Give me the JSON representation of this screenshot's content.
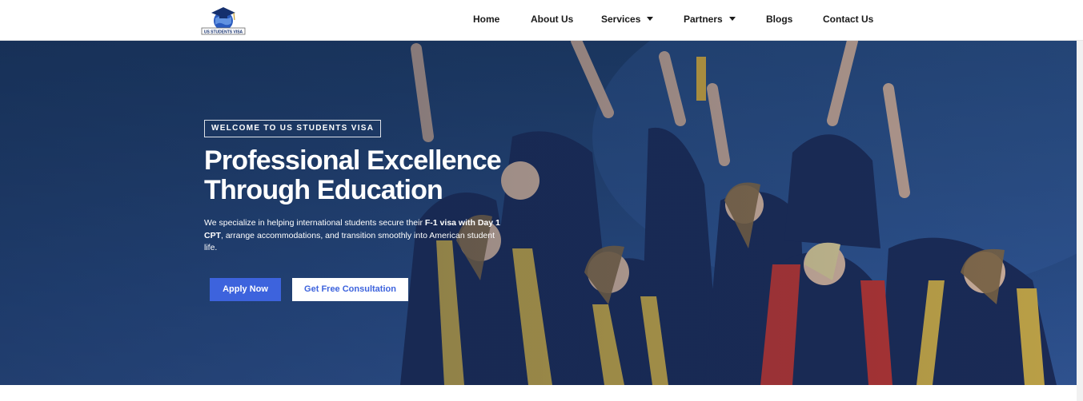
{
  "header": {
    "logo_text": "US STUDENTS VISA",
    "nav": [
      {
        "label": "Home"
      },
      {
        "label": "About Us"
      },
      {
        "label": "Services"
      },
      {
        "label": "Partners"
      },
      {
        "label": "Blogs"
      },
      {
        "label": "Contact Us"
      }
    ]
  },
  "hero": {
    "badge": "WELCOME TO US STUDENTS VISA",
    "title_line1": "Professional Excellence",
    "title_line2": "Through Education",
    "desc_part1": "We specialize in helping international students secure their ",
    "desc_bold": "F-1 visa with Day 1 CPT",
    "desc_part2": ", arrange accommodations, and transition smoothly into American student life.",
    "apply_label": "Apply Now",
    "consult_label": "Get Free Consultation"
  },
  "colors": {
    "accent": "#3d63dd",
    "hero_bg": "#26477a"
  }
}
